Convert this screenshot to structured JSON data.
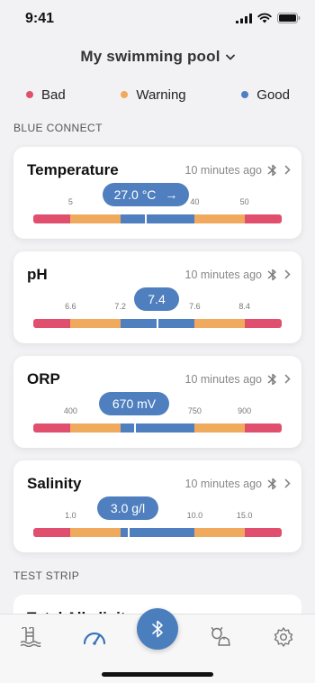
{
  "status_bar": {
    "time": "9:41"
  },
  "header": {
    "title": "My swimming pool"
  },
  "legend": [
    {
      "label": "Bad",
      "color": "#e0506e"
    },
    {
      "label": "Warning",
      "color": "#f0aa5e"
    },
    {
      "label": "Good",
      "color": "#4f7fbf"
    }
  ],
  "sections": {
    "blue_connect": "BLUE CONNECT",
    "test_strip": "TEST STRIP"
  },
  "measurements": [
    {
      "title": "Temperature",
      "time": "10 minutes ago",
      "value": "27.0 °C",
      "trend": "→",
      "ticks": [
        "5",
        "",
        "",
        "40",
        "50"
      ]
    },
    {
      "title": "pH",
      "time": "10 minutes ago",
      "value": "7.4",
      "ticks": [
        "6.6",
        "7.2",
        "",
        "7.6",
        "8.4"
      ]
    },
    {
      "title": "ORP",
      "time": "10 minutes ago",
      "value": "670 mV",
      "ticks": [
        "400",
        "",
        "",
        "750",
        "900"
      ]
    },
    {
      "title": "Salinity",
      "time": "10 minutes ago",
      "value": "3.0 g/l",
      "ticks": [
        "1.0",
        "",
        "",
        "10.0",
        "15.0"
      ]
    }
  ],
  "test_strip_card": {
    "title": "Total Alkalinity"
  },
  "tabs": [
    "pool-icon",
    "gauge-icon",
    "bluetooth-icon",
    "pets-icon",
    "gear-icon"
  ]
}
